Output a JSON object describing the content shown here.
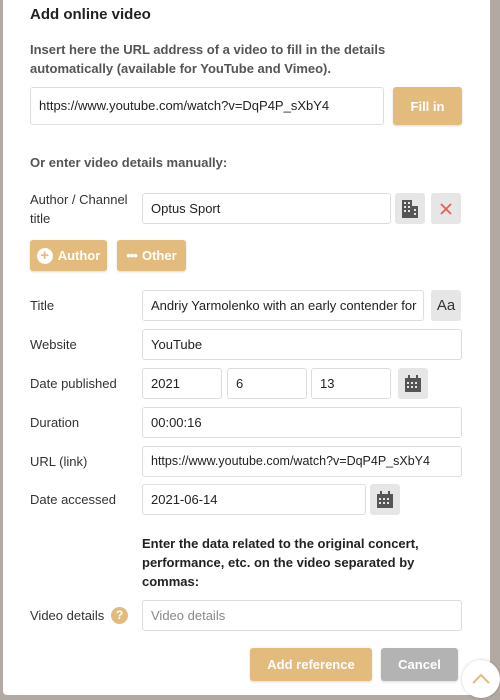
{
  "title": "Add online video",
  "intro": "Insert here the URL address of a video to fill in the details automatically (available for YouTube and Vimeo).",
  "url_input": "https://www.youtube.com/watch?v=DqP4P_sXbY4",
  "fill_in": "Fill in",
  "manual_heading": "Or enter video details manually:",
  "author": {
    "label": "Author / Channel title",
    "value": "Optus Sport"
  },
  "add_author": "Author",
  "other": "Other",
  "fields": {
    "title": {
      "label": "Title",
      "value": "Andriy Yarmolenko with an early contender for"
    },
    "website": {
      "label": "Website",
      "value": "YouTube"
    },
    "date_published": {
      "label": "Date published",
      "year": "2021",
      "month": "6",
      "day": "13"
    },
    "duration": {
      "label": "Duration",
      "value": "00:00:16"
    },
    "url": {
      "label": "URL (link)",
      "value": "https://www.youtube.com/watch?v=DqP4P_sXbY4"
    },
    "date_accessed": {
      "label": "Date accessed",
      "value": "2021-06-14"
    }
  },
  "details_note": "Enter the data related to the original concert, performance, etc. on the video separated by commas:",
  "video_details": {
    "label": "Video details",
    "placeholder": "Video details",
    "help": "?"
  },
  "add_reference": "Add reference",
  "cancel": "Cancel",
  "aa": "Aa",
  "colors": {
    "accent": "#e3bb7c",
    "cancel": "#b3b3b3"
  }
}
